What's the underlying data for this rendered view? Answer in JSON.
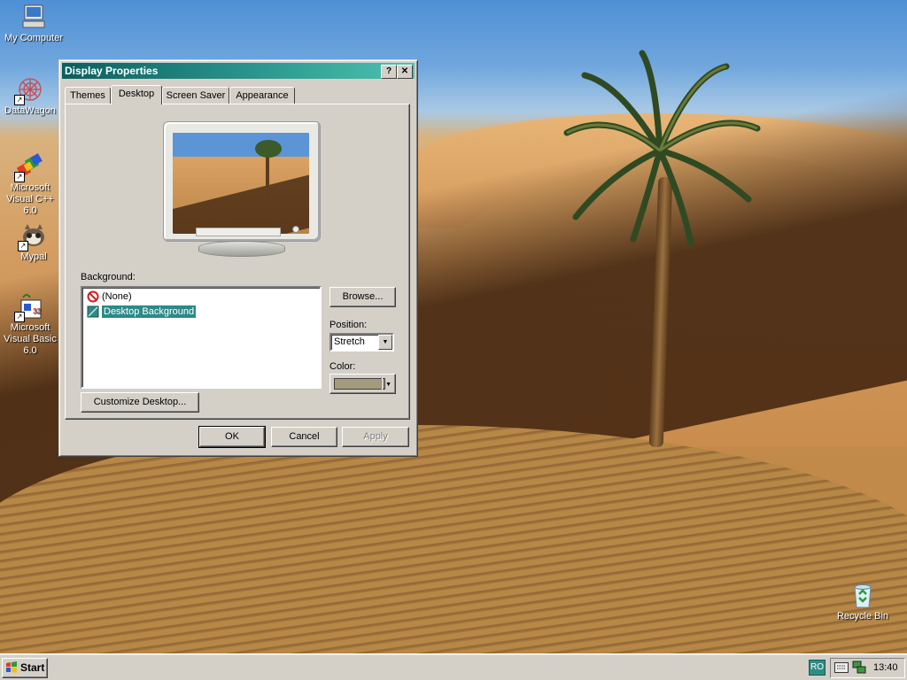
{
  "desktop": {
    "icons": [
      {
        "label": "My Computer",
        "icon": "my-computer-icon"
      },
      {
        "label": "DataWagon",
        "icon": "datawagon-icon"
      },
      {
        "label": "Microsoft Visual C++ 6.0",
        "icon": "visual-cpp-icon"
      },
      {
        "label": "Mypal",
        "icon": "mypal-icon"
      },
      {
        "label": "Microsoft Visual Basic 6.0",
        "icon": "visual-basic-icon"
      },
      {
        "label": "Recycle Bin",
        "icon": "recycle-bin-icon"
      }
    ]
  },
  "window": {
    "title": "Display Properties",
    "help_button": "?",
    "close_button": "✕",
    "tabs": [
      {
        "label": "Themes"
      },
      {
        "label": "Desktop",
        "active": true
      },
      {
        "label": "Screen Saver"
      },
      {
        "label": "Appearance"
      }
    ],
    "background_label": "Background:",
    "background_items": [
      {
        "label": "(None)",
        "icon": "none-icon"
      },
      {
        "label": "Desktop Background",
        "icon": "bitmap-icon",
        "selected": true
      }
    ],
    "browse_button": "Browse...",
    "position_label": "Position:",
    "position_value": "Stretch",
    "color_label": "Color:",
    "color_value": "#a39b7e",
    "customize_button": "Customize Desktop...",
    "ok_button": "OK",
    "cancel_button": "Cancel",
    "apply_button": "Apply"
  },
  "taskbar": {
    "start_label": "Start",
    "language": "RO",
    "clock": "13:40"
  }
}
